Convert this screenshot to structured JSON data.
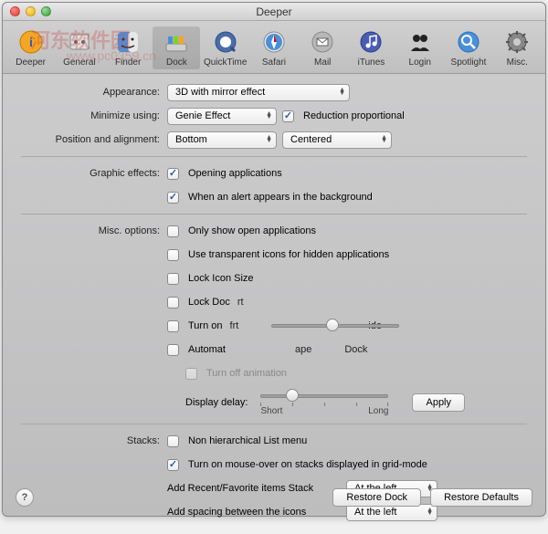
{
  "window": {
    "title": "Deeper"
  },
  "watermark": {
    "line1": "河东软件园",
    "line2": "www.pc0359.cn"
  },
  "toolbar": {
    "items": [
      {
        "label": "Deeper"
      },
      {
        "label": "General"
      },
      {
        "label": "Finder"
      },
      {
        "label": "Dock"
      },
      {
        "label": "QuickTime"
      },
      {
        "label": "Safari"
      },
      {
        "label": "Mail"
      },
      {
        "label": "iTunes"
      },
      {
        "label": "Login"
      },
      {
        "label": "Spotlight"
      },
      {
        "label": "Misc."
      }
    ]
  },
  "form": {
    "appearance_label": "Appearance:",
    "appearance_value": "3D with mirror effect",
    "minimize_label": "Minimize using:",
    "minimize_value": "Genie Effect",
    "reduction": "Reduction proportional",
    "position_label": "Position and alignment:",
    "position_value": "Bottom",
    "alignment_value": "Centered",
    "graphic_label": "Graphic effects:",
    "opening_apps": "Opening applications",
    "alert_bg": "When an alert appears in the background",
    "misc_label": "Misc. options:",
    "only_open": "Only show open applications",
    "transparent": "Use transparent icons for hidden applications",
    "lock_size": "Lock Icon Size",
    "lock_dock": "Lock Doc",
    "turn_on": "Turn on",
    "automat": "Automat",
    "frag1": "rt",
    "frag2": "frt",
    "frag3": "ide",
    "frag4": "ape",
    "frag5": "Dock",
    "turn_off_anim": "Turn off animation",
    "display_delay": "Display delay:",
    "short": "Short",
    "long": "Long",
    "apply": "Apply",
    "stacks_label": "Stacks:",
    "non_hier": "Non hierarchical List menu",
    "mouseover": "Turn on mouse-over on stacks displayed in grid-mode",
    "add_recent": "Add Recent/Favorite items Stack",
    "add_recent_value": "At the left",
    "add_spacing": "Add spacing between the icons",
    "add_spacing_value": "At the left"
  },
  "footer": {
    "restore_dock": "Restore Dock",
    "restore_defaults": "Restore Defaults"
  }
}
